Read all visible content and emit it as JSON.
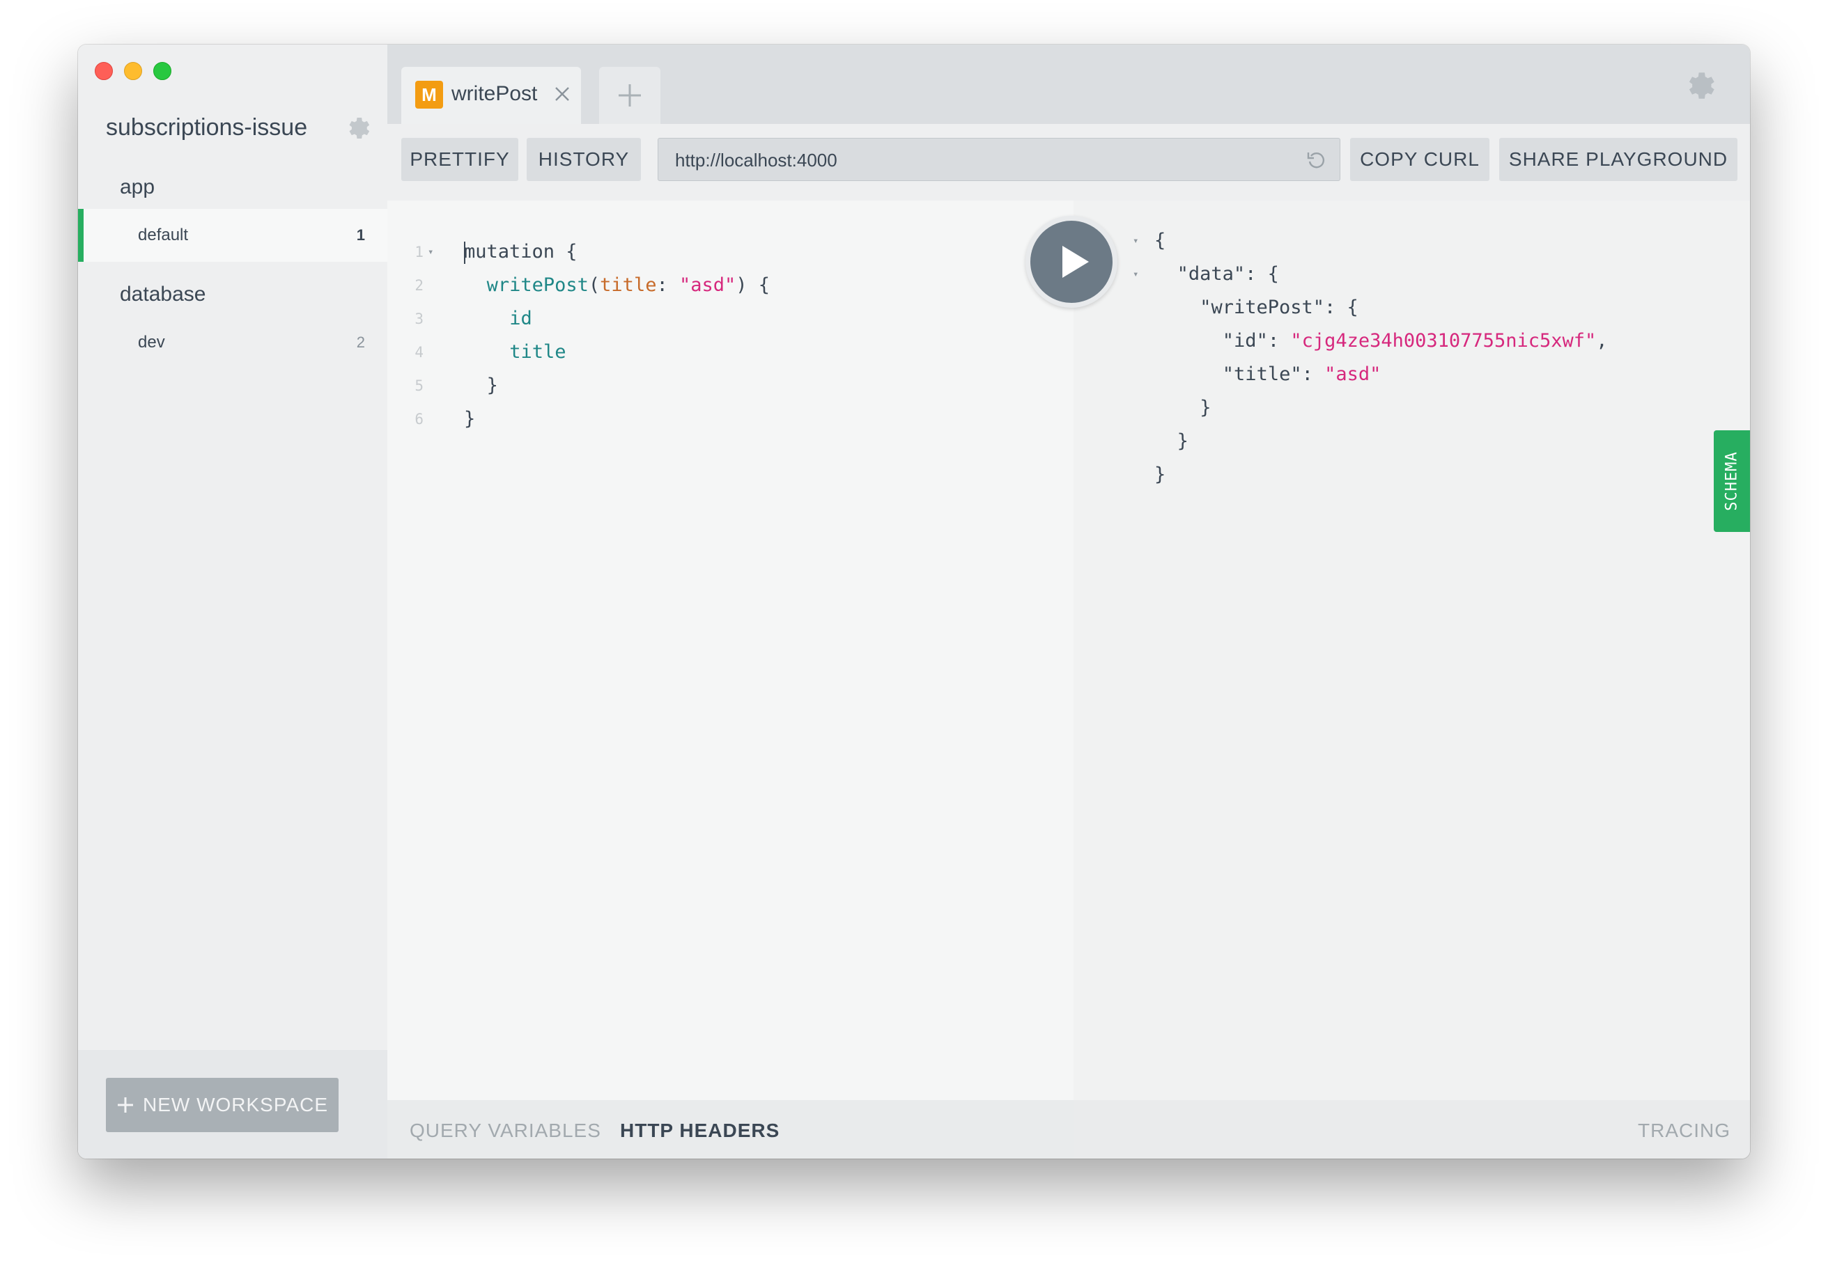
{
  "sidebar": {
    "project_title": "subscriptions-issue",
    "groups": [
      {
        "label": "app",
        "envs": [
          {
            "name": "default",
            "count": "1"
          }
        ]
      },
      {
        "label": "database",
        "envs": [
          {
            "name": "dev",
            "count": "2"
          }
        ]
      }
    ],
    "new_workspace_label": "NEW WORKSPACE"
  },
  "tabs": [
    {
      "badge": "M",
      "title": "writePost"
    }
  ],
  "toolbar": {
    "prettify_label": "PRETTIFY",
    "history_label": "HISTORY",
    "endpoint_url": "http://localhost:4000",
    "copy_curl_label": "COPY CURL",
    "share_label": "SHARE PLAYGROUND"
  },
  "editor": {
    "line_numbers": [
      "1",
      "2",
      "3",
      "4",
      "5",
      "6"
    ],
    "lines": [
      [
        {
          "t": "mutation {",
          "c": "plain"
        }
      ],
      [
        {
          "t": "writePost",
          "c": "teal"
        },
        {
          "t": "(",
          "c": "plain"
        },
        {
          "t": "title",
          "c": "orange"
        },
        {
          "t": ": ",
          "c": "plain"
        },
        {
          "t": "\"asd\"",
          "c": "pink"
        },
        {
          "t": ") {",
          "c": "plain"
        }
      ],
      [
        {
          "t": "id",
          "c": "teal"
        }
      ],
      [
        {
          "t": "title",
          "c": "teal"
        }
      ],
      [
        {
          "t": "}",
          "c": "plain"
        }
      ],
      [
        {
          "t": "}",
          "c": "plain"
        }
      ]
    ]
  },
  "response": {
    "lines": [
      [
        {
          "t": "{",
          "c": "plain"
        }
      ],
      [
        {
          "t": "\"data\": {",
          "c": "plain"
        }
      ],
      [
        {
          "t": "\"writePost\": {",
          "c": "plain"
        }
      ],
      [
        {
          "t": "\"id\": ",
          "c": "plain"
        },
        {
          "t": "\"cjg4ze34h003107755nic5xwf\"",
          "c": "pink"
        },
        {
          "t": ",",
          "c": "plain"
        }
      ],
      [
        {
          "t": "\"title\": ",
          "c": "plain"
        },
        {
          "t": "\"asd\"",
          "c": "pink"
        }
      ],
      [
        {
          "t": "}",
          "c": "plain"
        }
      ],
      [
        {
          "t": "}",
          "c": "plain"
        }
      ],
      [
        {
          "t": "}",
          "c": "plain"
        }
      ]
    ]
  },
  "schema_label": "SCHEMA",
  "bottom": {
    "query_variables_label": "QUERY VARIABLES",
    "http_headers_label": "HTTP HEADERS",
    "tracing_label": "TRACING"
  },
  "colors": {
    "accent_green": "#27ae60",
    "mutation_badge": "#f39c12",
    "string_pink": "#d6287d",
    "field_teal": "#1f8787",
    "arg_orange": "#c76b2a"
  }
}
